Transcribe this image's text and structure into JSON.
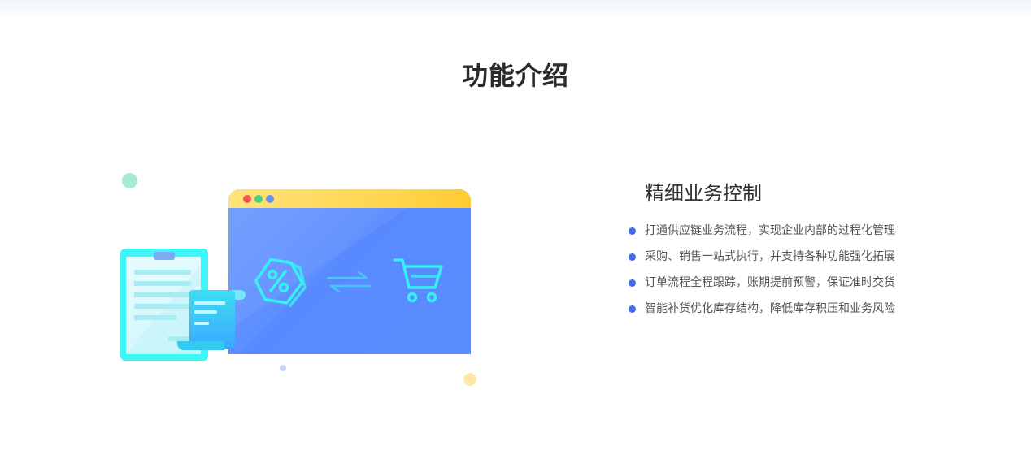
{
  "section": {
    "title": "功能介绍"
  },
  "feature": {
    "title": "精细业务控制",
    "bullet_color": "#3f6ee8",
    "items": [
      "打通供应链业务流程，实现企业内部的过程化管理",
      "采购、销售一站式执行，并支持各种功能强化拓展",
      "订单流程全程跟踪，账期提前预警，保证准时交货",
      "智能补货优化库存结构，降低库存积压和业务风险"
    ]
  },
  "illustration": {
    "browser_color": "#5a8cff",
    "bar_color": "#ffd54a",
    "accent_color": "#3ef6f7",
    "icons": [
      "discount-tag-icon",
      "exchange-arrows-icon",
      "shopping-cart-icon",
      "clipboard-icon",
      "receipt-icon"
    ]
  }
}
